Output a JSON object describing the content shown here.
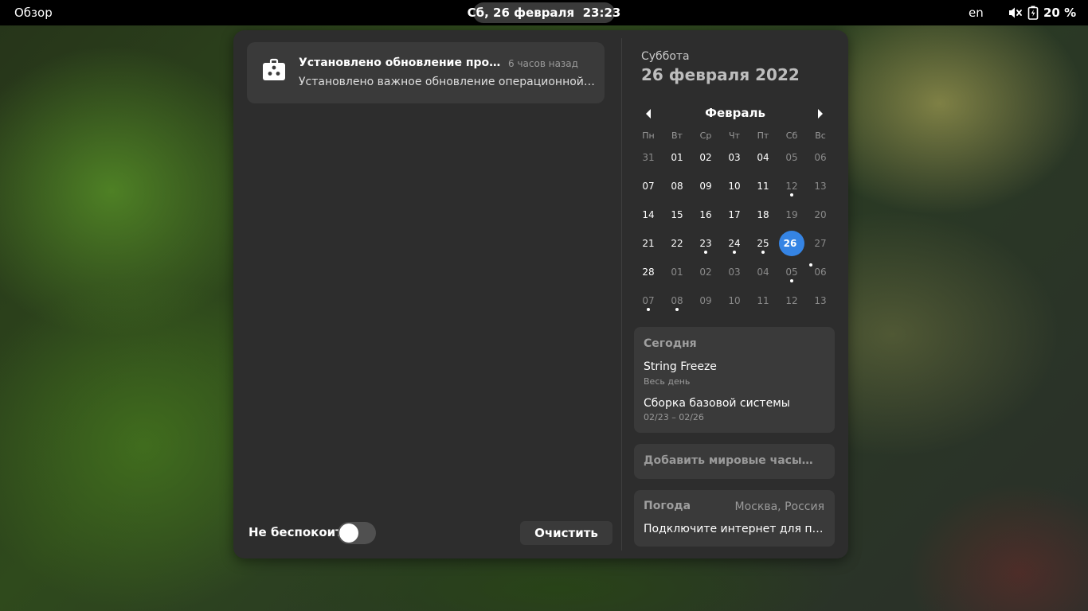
{
  "topbar": {
    "activities_label": "Обзор",
    "clock": "Сб, 26 февраля  23:23",
    "keyboard_layout": "en",
    "battery_label": "20 %",
    "volume_icon": "volume-muted-icon",
    "battery_icon": "battery-charging-icon"
  },
  "notifications": {
    "items": [
      {
        "icon": "software-update-icon",
        "title": "Установлено обновление программного обеспечения",
        "time": "6 часов назад",
        "body": "Установлено важное обновление операционной системы"
      }
    ],
    "dnd_label": "Не беспокоить",
    "dnd_enabled": false,
    "clear_label": "Очистить"
  },
  "calendar": {
    "weekday": "Суббота",
    "date_heading": "26 февраля 2022",
    "month": "Февраль",
    "weekday_headers": [
      "Пн",
      "Вт",
      "Ср",
      "Чт",
      "Пт",
      "Сб",
      "Вс"
    ],
    "weeks": [
      [
        {
          "d": "31",
          "muted": true
        },
        {
          "d": "01"
        },
        {
          "d": "02"
        },
        {
          "d": "03"
        },
        {
          "d": "04"
        },
        {
          "d": "05",
          "muted": true
        },
        {
          "d": "06",
          "muted": true
        }
      ],
      [
        {
          "d": "07"
        },
        {
          "d": "08"
        },
        {
          "d": "09"
        },
        {
          "d": "10"
        },
        {
          "d": "11"
        },
        {
          "d": "12",
          "muted": true,
          "event": true
        },
        {
          "d": "13",
          "muted": true
        }
      ],
      [
        {
          "d": "14"
        },
        {
          "d": "15"
        },
        {
          "d": "16"
        },
        {
          "d": "17"
        },
        {
          "d": "18"
        },
        {
          "d": "19",
          "muted": true
        },
        {
          "d": "20",
          "muted": true
        }
      ],
      [
        {
          "d": "21"
        },
        {
          "d": "22"
        },
        {
          "d": "23",
          "event": true
        },
        {
          "d": "24",
          "event": true
        },
        {
          "d": "25",
          "event": true
        },
        {
          "d": "26",
          "today": true,
          "event": true
        },
        {
          "d": "27",
          "muted": true
        }
      ],
      [
        {
          "d": "28"
        },
        {
          "d": "01",
          "muted": true
        },
        {
          "d": "02",
          "muted": true
        },
        {
          "d": "03",
          "muted": true
        },
        {
          "d": "04",
          "muted": true
        },
        {
          "d": "05",
          "muted": true,
          "event": true
        },
        {
          "d": "06",
          "muted": true
        }
      ],
      [
        {
          "d": "07",
          "muted": true,
          "event": true
        },
        {
          "d": "08",
          "muted": true,
          "event": true
        },
        {
          "d": "09",
          "muted": true
        },
        {
          "d": "10",
          "muted": true
        },
        {
          "d": "11",
          "muted": true
        },
        {
          "d": "12",
          "muted": true
        },
        {
          "d": "13",
          "muted": true
        }
      ]
    ],
    "today_color": "#3584e4"
  },
  "events": {
    "heading": "Сегодня",
    "items": [
      {
        "title": "String Freeze",
        "subtitle": "Весь день"
      },
      {
        "title": "Сборка базовой системы",
        "subtitle": "02/23 – 02/26"
      }
    ]
  },
  "world_clocks": {
    "label": "Добавить мировые часы…"
  },
  "weather": {
    "title": "Погода",
    "location": "Москва, Россия",
    "message": "Подключите интернет для получения сведений о погоде"
  }
}
